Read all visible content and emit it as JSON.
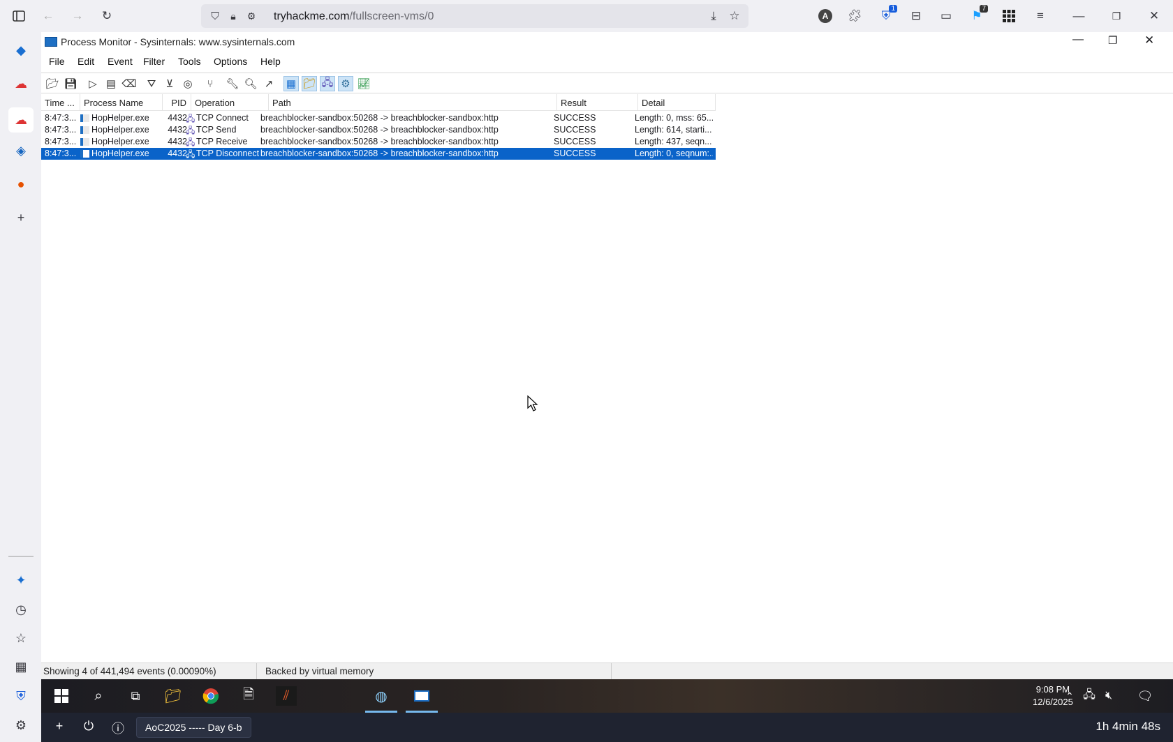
{
  "browser": {
    "url_domain": "tryhackme.com",
    "url_path": "/fullscreen-vms/0",
    "badge_bitwarden": "1",
    "badge_ext": "7"
  },
  "window": {
    "title": "Process Monitor - Sysinternals: www.sysinternals.com"
  },
  "menu": [
    "File",
    "Edit",
    "Event",
    "Filter",
    "Tools",
    "Options",
    "Help"
  ],
  "columns": [
    "Time ...",
    "Process Name",
    "PID",
    "Operation",
    "Path",
    "Result",
    "Detail"
  ],
  "rows": [
    {
      "time": "8:47:3...",
      "process": "HopHelper.exe",
      "pid": "4432",
      "operation": "TCP Connect",
      "path": "breachblocker-sandbox:50268 -> breachblocker-sandbox:http",
      "result": "SUCCESS",
      "detail": "Length: 0, mss: 65..."
    },
    {
      "time": "8:47:3...",
      "process": "HopHelper.exe",
      "pid": "4432",
      "operation": "TCP Send",
      "path": "breachblocker-sandbox:50268 -> breachblocker-sandbox:http",
      "result": "SUCCESS",
      "detail": "Length: 614, starti..."
    },
    {
      "time": "8:47:3...",
      "process": "HopHelper.exe",
      "pid": "4432",
      "operation": "TCP Receive",
      "path": "breachblocker-sandbox:50268 -> breachblocker-sandbox:http",
      "result": "SUCCESS",
      "detail": "Length: 437, seqn..."
    },
    {
      "time": "8:47:3...",
      "process": "HopHelper.exe",
      "pid": "4432",
      "operation": "TCP Disconnect",
      "path": "breachblocker-sandbox:50268 -> breachblocker-sandbox:http",
      "result": "SUCCESS",
      "detail": "Length: 0, seqnum:..."
    }
  ],
  "selected_row": 3,
  "status": {
    "events": "Showing 4 of 441,494 events (0.00090%)",
    "memory": "Backed by virtual memory"
  },
  "clock": {
    "time": "9:08 PM",
    "date": "12/6/2025"
  },
  "footer": {
    "session": "AoC2025 ----- Day 6-b",
    "timer": "1h 4min 48s"
  },
  "colors": {
    "selection": "#0a63c9",
    "chrome": "#f0f0f4",
    "footer": "#1f2330"
  }
}
